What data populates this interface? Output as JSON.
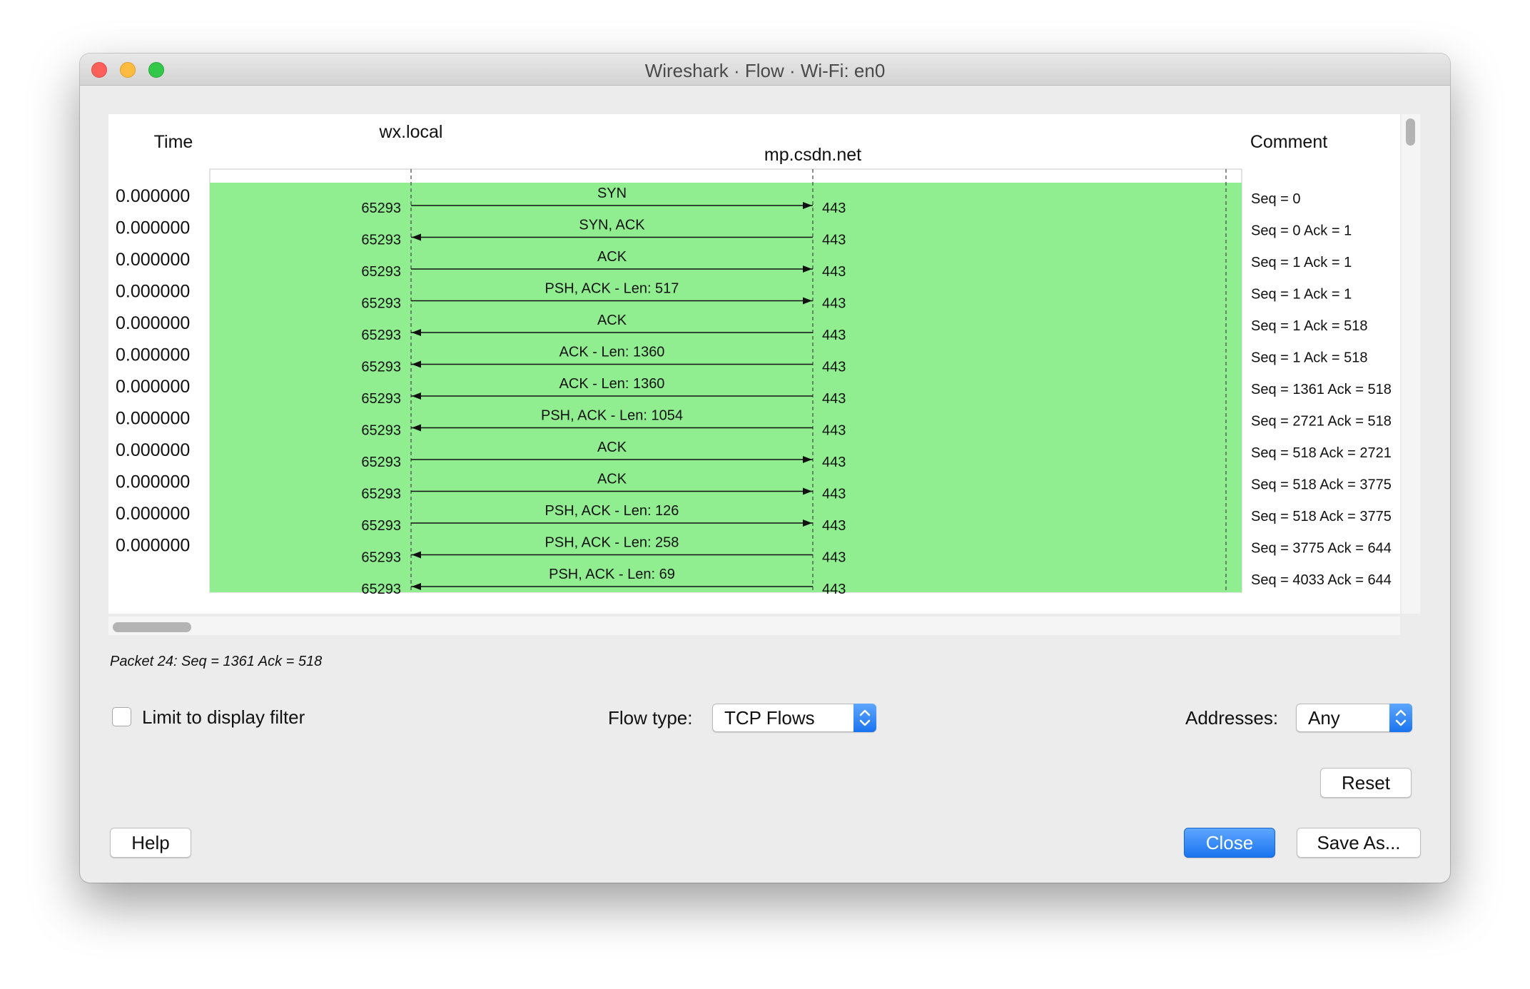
{
  "window": {
    "title": "Wireshark · Flow · Wi-Fi: en0"
  },
  "diagram": {
    "time_header": "Time",
    "comment_header": "Comment",
    "nodes": [
      "wx.local",
      "mp.csdn.net"
    ],
    "fill_color": "#90ee90",
    "rows": [
      {
        "time": "0.000000",
        "src_port": "65293",
        "dst_port": "443",
        "label": "SYN",
        "direction": "right",
        "comment": "Seq = 0"
      },
      {
        "time": "0.000000",
        "src_port": "65293",
        "dst_port": "443",
        "label": "SYN, ACK",
        "direction": "left",
        "comment": "Seq = 0 Ack = 1"
      },
      {
        "time": "0.000000",
        "src_port": "65293",
        "dst_port": "443",
        "label": "ACK",
        "direction": "right",
        "comment": "Seq = 1 Ack = 1"
      },
      {
        "time": "0.000000",
        "src_port": "65293",
        "dst_port": "443",
        "label": "PSH, ACK - Len: 517",
        "direction": "right",
        "comment": "Seq = 1 Ack = 1"
      },
      {
        "time": "0.000000",
        "src_port": "65293",
        "dst_port": "443",
        "label": "ACK",
        "direction": "left",
        "comment": "Seq = 1 Ack = 518"
      },
      {
        "time": "0.000000",
        "src_port": "65293",
        "dst_port": "443",
        "label": "ACK - Len: 1360",
        "direction": "left",
        "comment": "Seq = 1 Ack = 518"
      },
      {
        "time": "0.000000",
        "src_port": "65293",
        "dst_port": "443",
        "label": "ACK - Len: 1360",
        "direction": "left",
        "comment": "Seq = 1361 Ack = 518"
      },
      {
        "time": "0.000000",
        "src_port": "65293",
        "dst_port": "443",
        "label": "PSH, ACK - Len: 1054",
        "direction": "left",
        "comment": "Seq = 2721 Ack = 518"
      },
      {
        "time": "0.000000",
        "src_port": "65293",
        "dst_port": "443",
        "label": "ACK",
        "direction": "right",
        "comment": "Seq = 518 Ack = 2721"
      },
      {
        "time": "0.000000",
        "src_port": "65293",
        "dst_port": "443",
        "label": "ACK",
        "direction": "right",
        "comment": "Seq = 518 Ack = 3775"
      },
      {
        "time": "0.000000",
        "src_port": "65293",
        "dst_port": "443",
        "label": "PSH, ACK - Len: 126",
        "direction": "right",
        "comment": "Seq = 518 Ack = 3775"
      },
      {
        "time": "0.000000",
        "src_port": "65293",
        "dst_port": "443",
        "label": "PSH, ACK - Len: 258",
        "direction": "left",
        "comment": "Seq = 3775 Ack = 644"
      },
      {
        "time": "",
        "src_port": "65293",
        "dst_port": "443",
        "label": "PSH, ACK - Len: 69",
        "direction": "left",
        "comment": "Seq = 4033 Ack = 644"
      }
    ]
  },
  "status": {
    "text": "Packet 24: Seq = 1361 Ack = 518"
  },
  "controls": {
    "limit_filter_label": "Limit to display filter",
    "limit_filter_checked": false,
    "flow_type_label": "Flow type:",
    "flow_type_value": "TCP Flows",
    "addresses_label": "Addresses:",
    "addresses_value": "Any",
    "reset_label": "Reset",
    "help_label": "Help",
    "close_label": "Close",
    "save_as_label": "Save As..."
  }
}
